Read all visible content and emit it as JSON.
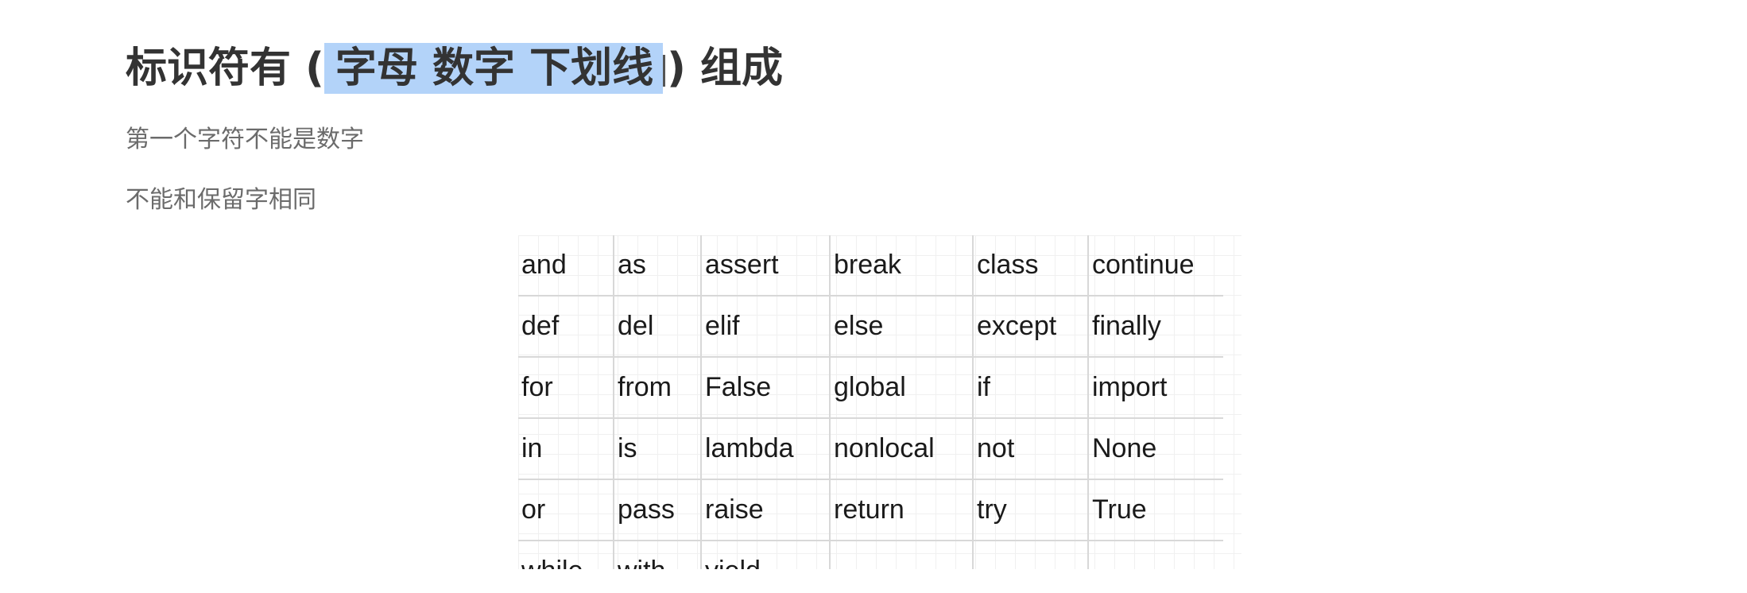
{
  "heading": {
    "prefix": "标识符有 (",
    "highlighted": "字母 数字 下划线",
    "suffix": ") 组成"
  },
  "paragraphs": [
    "第一个字符不能是数字",
    "不能和保留字相同"
  ],
  "keywords_table": {
    "rows": [
      [
        "and",
        "as",
        "assert",
        "break",
        "class",
        "continue"
      ],
      [
        "def",
        "del",
        "elif",
        "else",
        "except",
        "finally"
      ],
      [
        "for",
        "from",
        "False",
        "global",
        "if",
        "import"
      ],
      [
        "in",
        "is",
        "lambda",
        "nonlocal",
        "not",
        "None"
      ],
      [
        "or",
        "pass",
        "raise",
        "return",
        "try",
        "True"
      ],
      [
        "while",
        "with",
        "yield",
        "",
        "",
        ""
      ]
    ]
  },
  "colors": {
    "selection_highlight": "#b3d3f9",
    "heading_text": "#333333",
    "paragraph_text": "#6b6b6b"
  }
}
